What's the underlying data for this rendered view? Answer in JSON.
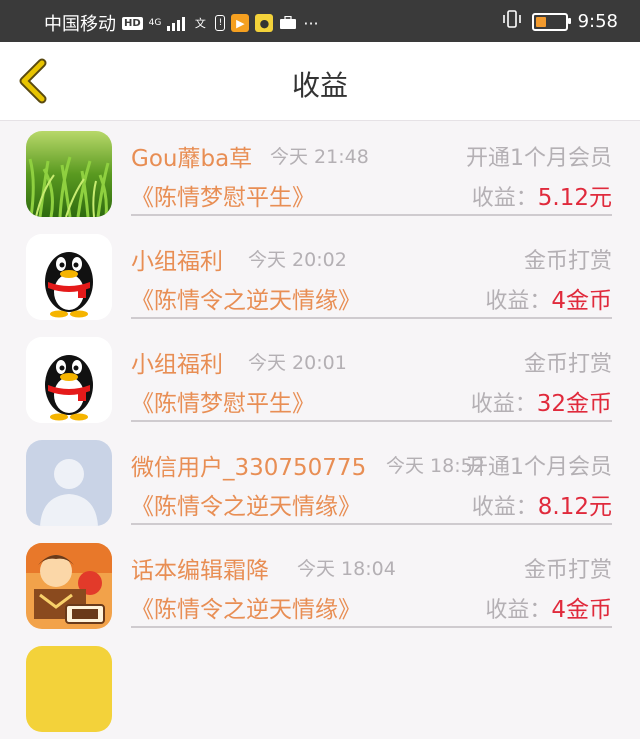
{
  "status_bar": {
    "carrier": "中国移动",
    "hd": "HD",
    "network": "4G",
    "time": "9:58"
  },
  "header": {
    "title": "收益",
    "back_icon": "chevron-left-icon",
    "accent_color": "#e8b800"
  },
  "colors": {
    "name": "#e88e54",
    "muted": "#b4b0b4",
    "amount": "#e02a3c"
  },
  "earnings": [
    {
      "name": "Gou蘼ba草",
      "time": "今天 21:48",
      "type": "开通1个月会员",
      "book": "《陈情梦慰平生》",
      "earn_label": "收益：",
      "earn_value": "5.12元",
      "avatar": "grass-photo"
    },
    {
      "name": "小组福利",
      "time": "今天 20:02",
      "type": "金币打赏",
      "book": "《陈情令之逆天情缘》",
      "earn_label": "收益：",
      "earn_value": "4金币",
      "avatar": "penguin"
    },
    {
      "name": "小组福利",
      "time": "今天 20:01",
      "type": "金币打赏",
      "book": "《陈情梦慰平生》",
      "earn_label": "收益：",
      "earn_value": "32金币",
      "avatar": "penguin"
    },
    {
      "name": "微信用户_330750775",
      "time": "今天 18:52",
      "type": "开通1个月会员",
      "book": "《陈情令之逆天情缘》",
      "earn_label": "收益：",
      "earn_value": "8.12元",
      "avatar": "default-user"
    },
    {
      "name": "话本编辑霜降",
      "time": "今天 18:04",
      "type": "金币打赏",
      "book": "《陈情令之逆天情缘》",
      "earn_label": "收益：",
      "earn_value": "4金币",
      "avatar": "cartoon"
    }
  ]
}
